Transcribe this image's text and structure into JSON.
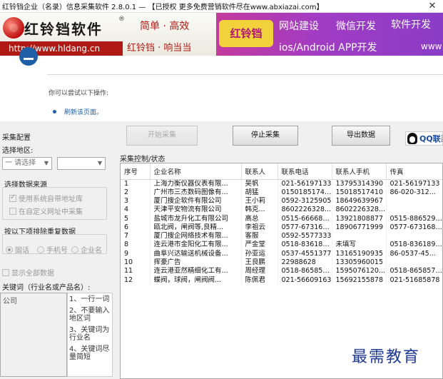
{
  "window": {
    "title": "红铃铛企业（名录）信息采集软件 2.8.0.1 — 【已授权 更多免费营销软件尽在www.abxiazai.com】",
    "close_glyph": "✕"
  },
  "banner": {
    "brand": "红铃铛软件",
    "reg": "®",
    "url": "http://www.hldang.cn",
    "slogan1": "简单 · 高效",
    "slogan2": "红铃铛 · 响当当",
    "ad_logo": "红铃铛",
    "ad1": "网站建设",
    "ad2": "微信开发",
    "ad3": "软件开发",
    "ad4": "ios/Android APP开发",
    "ad5": "www"
  },
  "web": {
    "hint": "你可以尝试以下操作:",
    "refresh": "刷新该页面。"
  },
  "left": {
    "config_title": "采集配置",
    "region_label": "选择地区:",
    "region_select": "一 请选择",
    "region_select2": "",
    "source_title": "选择数据来源",
    "use_system": "使用系统自带地址库",
    "custom_url": "在自定义网址中采集",
    "dedupe_title": "按以下项排除重复数据",
    "radio_fixed": "固话",
    "radio_mobile": "手机号",
    "radio_company": "企业名",
    "show_all": "显示全部数据",
    "keyword_label": "关键词（行业名或产品名）:",
    "keyword_placeholder": "公司",
    "tips": [
      "1、一行一词",
      "2、不要输入地区词",
      "3、关键词为行业名",
      "4、关键词尽量简短"
    ]
  },
  "toolbar": {
    "start": "开始采集",
    "stop": "停止采集",
    "export": "导出数据",
    "qq": "QQ联系"
  },
  "table": {
    "title": "采集控制/状态",
    "headers": [
      "序号",
      "企业名称",
      "联系人",
      "联系电话",
      "联系人手机",
      "传真"
    ],
    "rows": [
      [
        "1",
        "上海力衡仪器仪表有限...",
        "吴帆",
        "021-56197133",
        "13795314390",
        "021-56197133"
      ],
      [
        "2",
        "广州市三杰数码图像有...",
        "胡猛",
        "015018517410",
        "15018517410",
        "86-020-312..."
      ],
      [
        "3",
        "厦门搜企软件有限公司",
        "王小莉",
        "0592-3125905",
        "18649639967",
        ""
      ],
      [
        "4",
        "天津平安物流有限公司",
        "韩克...",
        "8602226328...",
        "8602226328...",
        ""
      ],
      [
        "5",
        "盐城市龙升化工有限公司",
        "高总",
        "0515-66668866",
        "13921808877",
        "0515-88652999"
      ],
      [
        "6",
        "瓯北阀，闸阀等,良精...",
        "李祖云",
        "0577-67316999",
        "18906771999",
        "0577-67316880"
      ],
      [
        "7",
        "厦门搜企网络技术有限...",
        "客服",
        "0592-5577333",
        "",
        ""
      ],
      [
        "8",
        "连云港市金阳化工有限...",
        "严金堂",
        "0518-83618188",
        "未填写",
        "0518-83618998"
      ],
      [
        "9",
        "曲阜兴达输送机械设备...",
        "孙亚运",
        "0537-4551377",
        "13165190935",
        "86-0537-45..."
      ],
      [
        "10",
        "挥豪广告",
        "王良鹏",
        "22988628",
        "13305960015",
        ""
      ],
      [
        "11",
        "连云港亚然精细化工有...",
        "周经理",
        "0518-86585333",
        "1595076120...",
        "0518-86585779"
      ],
      [
        "12",
        "蝶阀，球阀，闸阀阀...",
        "陈佩君",
        "021-56609163",
        "15692155878",
        "021-51685878"
      ]
    ]
  },
  "watermark": "最需教育"
}
